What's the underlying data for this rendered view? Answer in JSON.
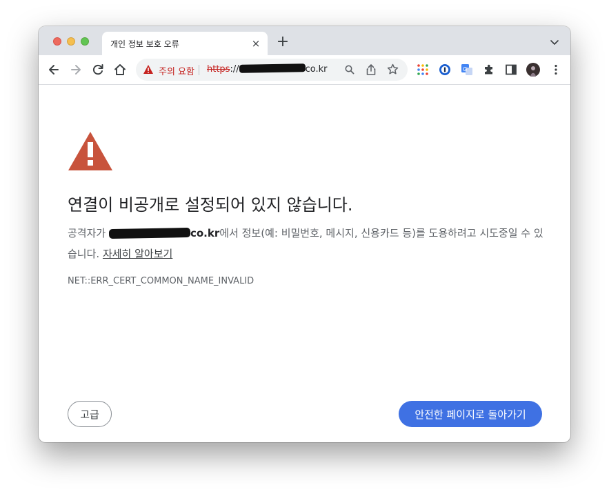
{
  "tab": {
    "title": "개인 정보 보호 오류",
    "close_glyph": "×",
    "new_tab_glyph": "+"
  },
  "omnibox": {
    "warning_label": "주의 요함",
    "url_scheme": "https",
    "url_separator": "://",
    "url_suffix": "co.kr"
  },
  "toolbar_icons": [
    "back-icon",
    "forward-icon",
    "reload-icon",
    "home-icon",
    "zoom-icon",
    "share-icon",
    "bookmark-star-icon",
    "apps-grid-icon",
    "password-manager-icon",
    "translate-icon",
    "extensions-puzzle-icon",
    "side-panel-icon",
    "profile-avatar",
    "more-menu-icon"
  ],
  "interstitial": {
    "heading": "연결이 비공개로 설정되어 있지 않습니다.",
    "explanation_prefix": "공격자가 ",
    "host_suffix": "co.kr",
    "explanation_suffix": "에서 정보(예: 비밀번호, 메시지, 신용카드 등)를 도용하려고 시도중일 수 있습니다. ",
    "learn_more": "자세히 알아보기",
    "error_code": "NET::ERR_CERT_COMMON_NAME_INVALID",
    "advanced_button": "고급",
    "back_button": "안전한 페이지로 돌아가기"
  },
  "colors": {
    "accent": "#3f71e3",
    "warning": "#c5221f",
    "error_icon": "#c8533c"
  }
}
